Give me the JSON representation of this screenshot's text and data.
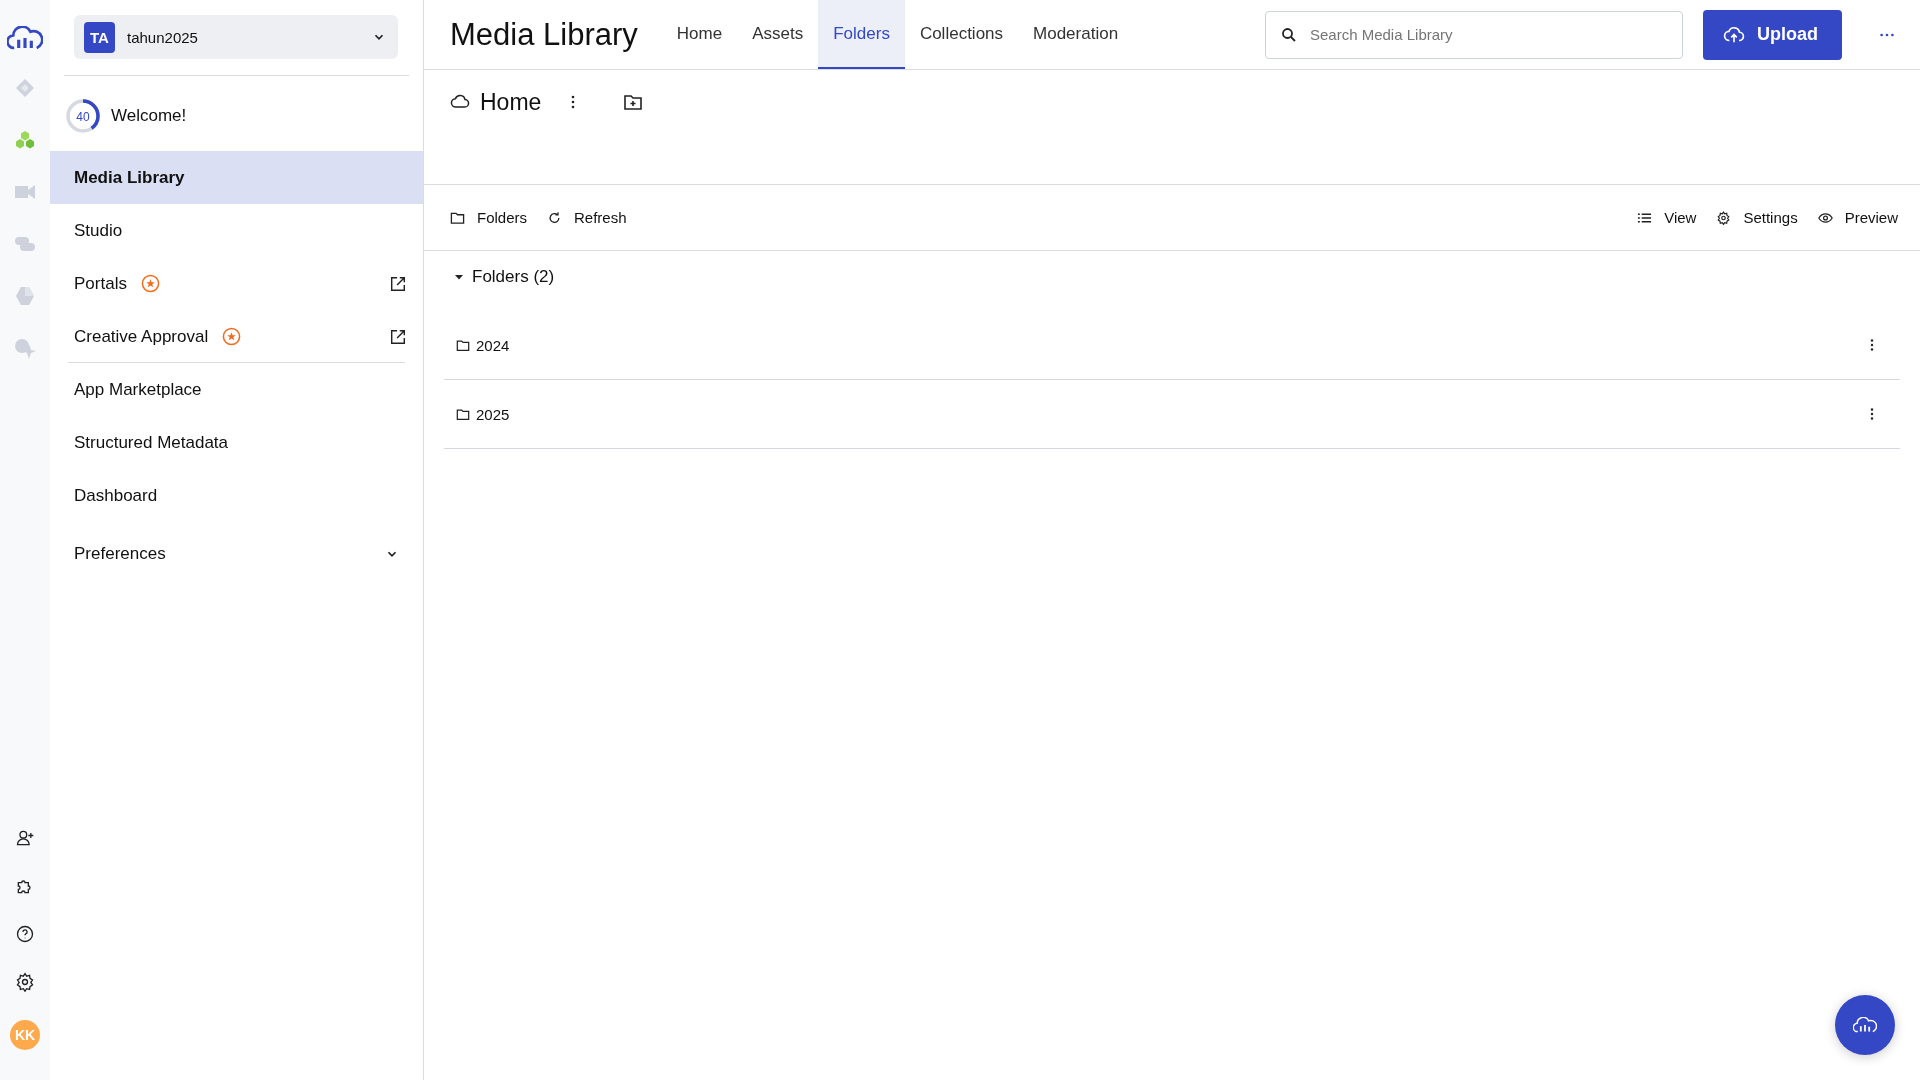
{
  "account": {
    "initials": "TA",
    "name": "tahun2025"
  },
  "welcome": {
    "progress": "40",
    "level": 0.4,
    "label": "Welcome!"
  },
  "sidebar": {
    "items": [
      {
        "label": "Media Library",
        "selected": true,
        "new_badge": false,
        "external": false,
        "divider_after": false
      },
      {
        "label": "Studio",
        "selected": false,
        "new_badge": false,
        "external": false,
        "divider_after": false
      },
      {
        "label": "Portals",
        "selected": false,
        "new_badge": true,
        "external": true,
        "divider_after": false
      },
      {
        "label": "Creative Approval",
        "selected": false,
        "new_badge": true,
        "external": true,
        "divider_after": true
      },
      {
        "label": "App Marketplace",
        "selected": false,
        "new_badge": false,
        "external": false,
        "divider_after": false
      },
      {
        "label": "Structured Metadata",
        "selected": false,
        "new_badge": false,
        "external": false,
        "divider_after": false
      },
      {
        "label": "Dashboard",
        "selected": false,
        "new_badge": false,
        "external": false,
        "divider_after": false
      }
    ],
    "preferences": {
      "label": "Preferences",
      "expanded": false
    }
  },
  "user": {
    "initials": "KK"
  },
  "header": {
    "title": "Media Library",
    "tabs": [
      {
        "label": "Home",
        "selected": false
      },
      {
        "label": "Assets",
        "selected": false
      },
      {
        "label": "Folders",
        "selected": true
      },
      {
        "label": "Collections",
        "selected": false
      },
      {
        "label": "Moderation",
        "selected": false
      }
    ],
    "search": {
      "placeholder": "Search Media Library"
    },
    "upload_button": "Upload"
  },
  "breadcrumb": {
    "label": "Home"
  },
  "toolbar": {
    "left": [
      {
        "kind": "folder",
        "label": "Folders"
      },
      {
        "kind": "refresh",
        "label": "Refresh"
      }
    ],
    "right": [
      {
        "kind": "list",
        "label": "View"
      },
      {
        "kind": "gear",
        "label": "Settings"
      },
      {
        "kind": "eye",
        "label": "Preview"
      }
    ]
  },
  "folders": {
    "title": "Folders (2)",
    "expanded": true,
    "rows": [
      {
        "name": "2024"
      },
      {
        "name": "2025"
      }
    ]
  }
}
